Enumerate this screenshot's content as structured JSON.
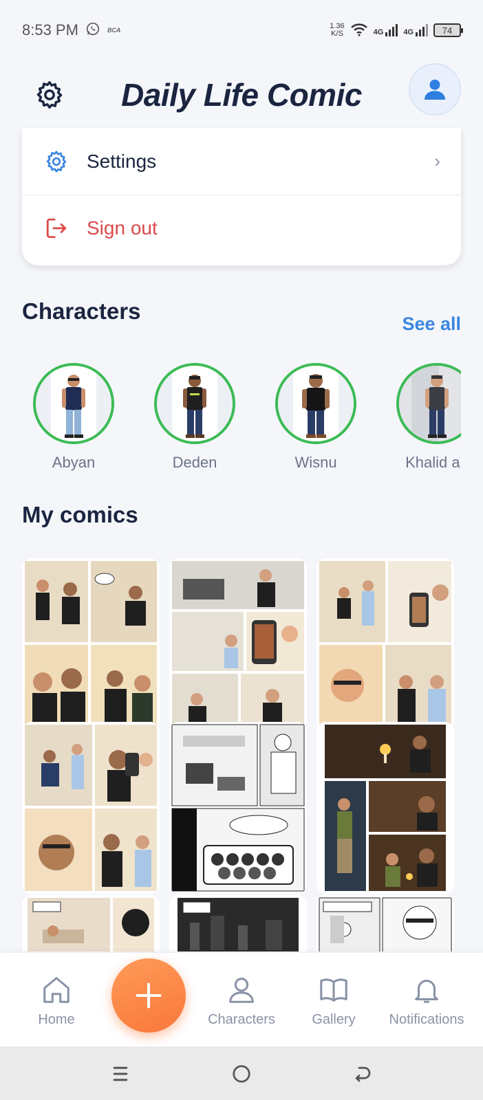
{
  "status_bar": {
    "time": "8:53 PM",
    "speed_value": "1.36",
    "speed_unit": "K/S",
    "network_1": "4G",
    "network_2": "4G",
    "battery": "74",
    "carrier_label": "BCA"
  },
  "header": {
    "title": "Daily Life Comic"
  },
  "menu": {
    "settings_label": "Settings",
    "sign_out_label": "Sign out"
  },
  "characters": {
    "title": "Characters",
    "see_all_label": "See all",
    "items": [
      {
        "name": "Abyan",
        "shirt": "#1f2d55"
      },
      {
        "name": "Deden",
        "shirt": "#1f1f1f"
      },
      {
        "name": "Wisnu",
        "shirt": "#151515"
      },
      {
        "name": "Khalid ah",
        "shirt": "#3a3d44"
      }
    ]
  },
  "comics": {
    "title": "My comics",
    "items": [
      {
        "name": "comic-1",
        "style": "color"
      },
      {
        "name": "comic-2",
        "style": "color"
      },
      {
        "name": "comic-3",
        "style": "color"
      },
      {
        "name": "comic-4",
        "style": "color"
      },
      {
        "name": "comic-5",
        "style": "bw"
      },
      {
        "name": "comic-6",
        "style": "dark"
      },
      {
        "name": "comic-7",
        "style": "color"
      },
      {
        "name": "comic-8",
        "style": "bw"
      },
      {
        "name": "comic-9",
        "style": "bw"
      }
    ]
  },
  "bottom_nav": {
    "home_label": "Home",
    "characters_label": "Characters",
    "gallery_label": "Gallery",
    "notifications_label": "Notifications"
  },
  "colors": {
    "accent": "#3a86df",
    "danger": "#dc4a4a",
    "fab": "#f9773a",
    "ring": "#3cbb55",
    "title": "#1b2540"
  }
}
